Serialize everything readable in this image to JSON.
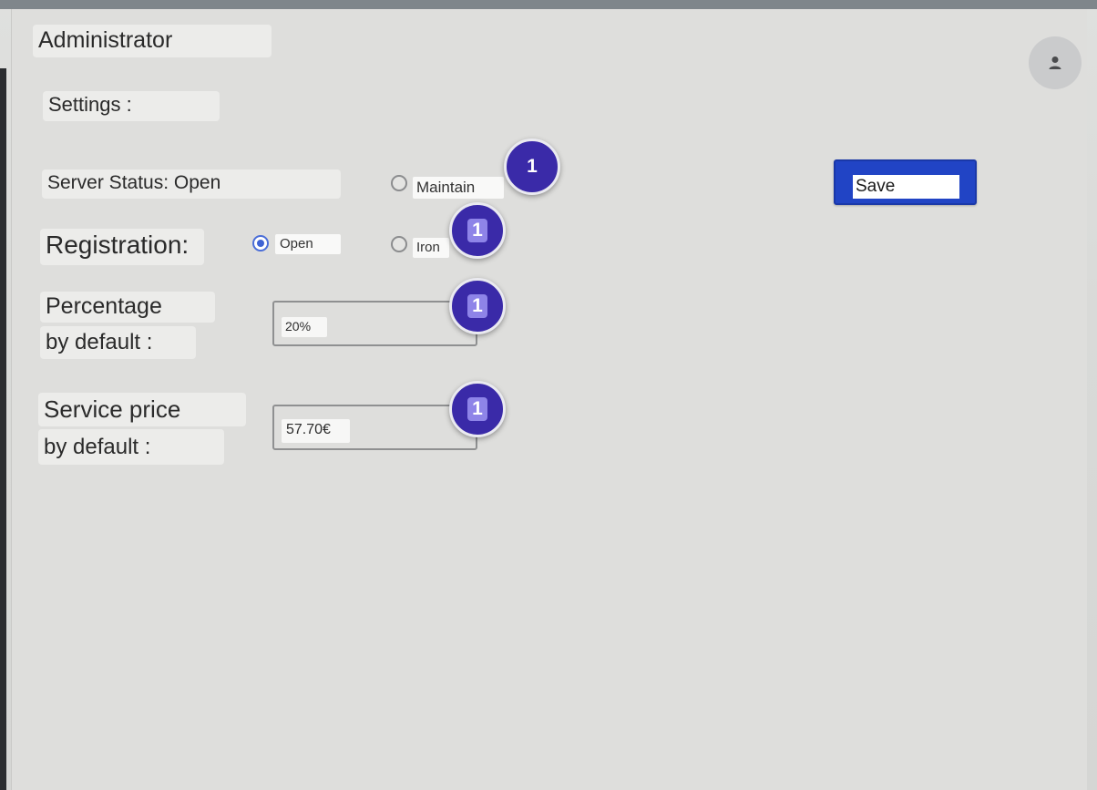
{
  "header": {
    "title": "Administrator",
    "avatar_icon": "user-icon"
  },
  "settings": {
    "title": "Settings :",
    "server_status": {
      "label": "Server Status: Open",
      "options": [
        {
          "label": "Maintain",
          "selected": false
        }
      ]
    },
    "registration": {
      "label": "Registration:",
      "options": [
        {
          "label": "Open",
          "selected": true
        },
        {
          "label": "Iron",
          "selected": false
        }
      ]
    },
    "percentage": {
      "label_line1": "Percentage",
      "label_line2": "by default :",
      "value": "20%"
    },
    "service_price": {
      "label_line1": "Service price",
      "label_line2": "by default :",
      "value": "57.70€"
    },
    "save_label": "Save"
  },
  "badges": [
    "1",
    "1",
    "1",
    "1"
  ],
  "colors": {
    "accent": "#2144c5",
    "badge": "#3a2aa8",
    "background": "#dededc"
  }
}
